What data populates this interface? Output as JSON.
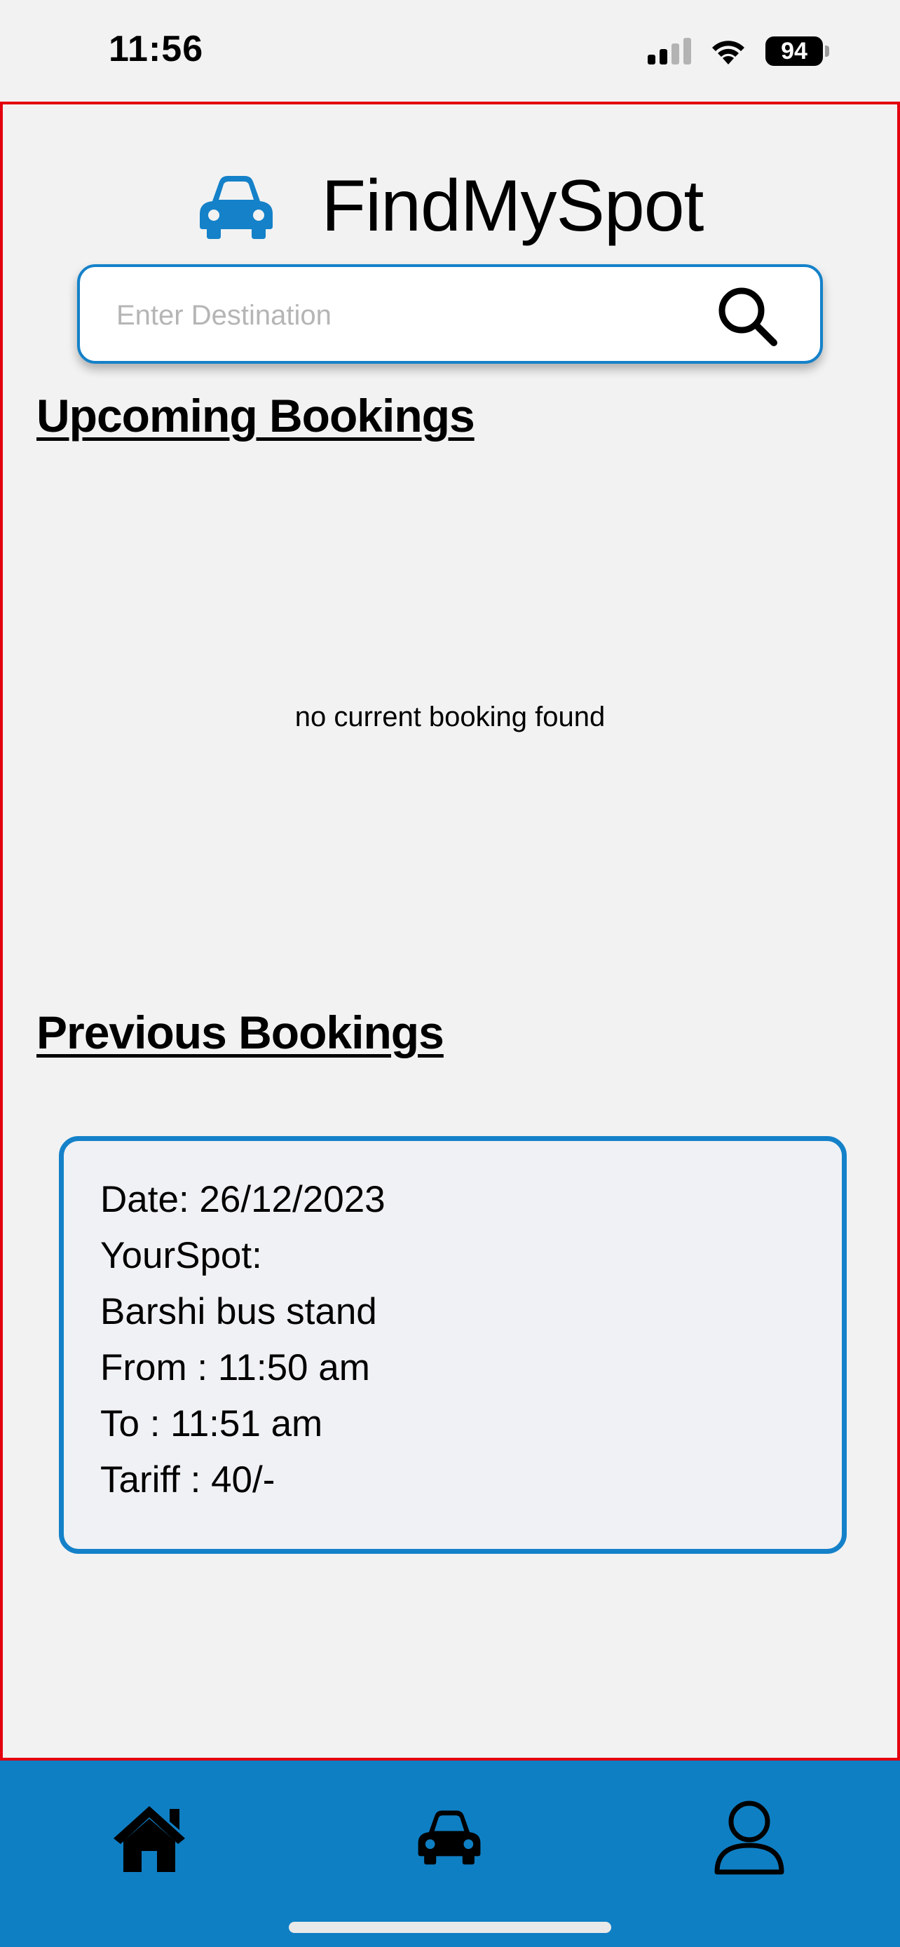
{
  "status_bar": {
    "time": "11:56",
    "battery": "94"
  },
  "header": {
    "title": "FindMySpot"
  },
  "search": {
    "placeholder": "Enter Destination",
    "value": ""
  },
  "upcoming": {
    "heading": "Upcoming Bookings",
    "empty_message": "no current booking found"
  },
  "previous": {
    "heading": "Previous Bookings",
    "bookings": [
      {
        "date": "Date: 26/12/2023",
        "spot_label": "YourSpot:",
        "spot_name": "Barshi bus stand",
        "from": "From : 11:50 am",
        "to": "To : 11:51 am",
        "tariff": "Tariff : 40/-"
      }
    ]
  },
  "bottom_nav": {
    "items": [
      {
        "icon": "home-icon"
      },
      {
        "icon": "car-icon"
      },
      {
        "icon": "user-icon"
      }
    ]
  },
  "colors": {
    "accent": "#1481c9",
    "nav_background": "#0f7fc4",
    "frame_outline": "#e3000f",
    "background": "#f2f2f2",
    "card_background": "#f0f1f4"
  }
}
